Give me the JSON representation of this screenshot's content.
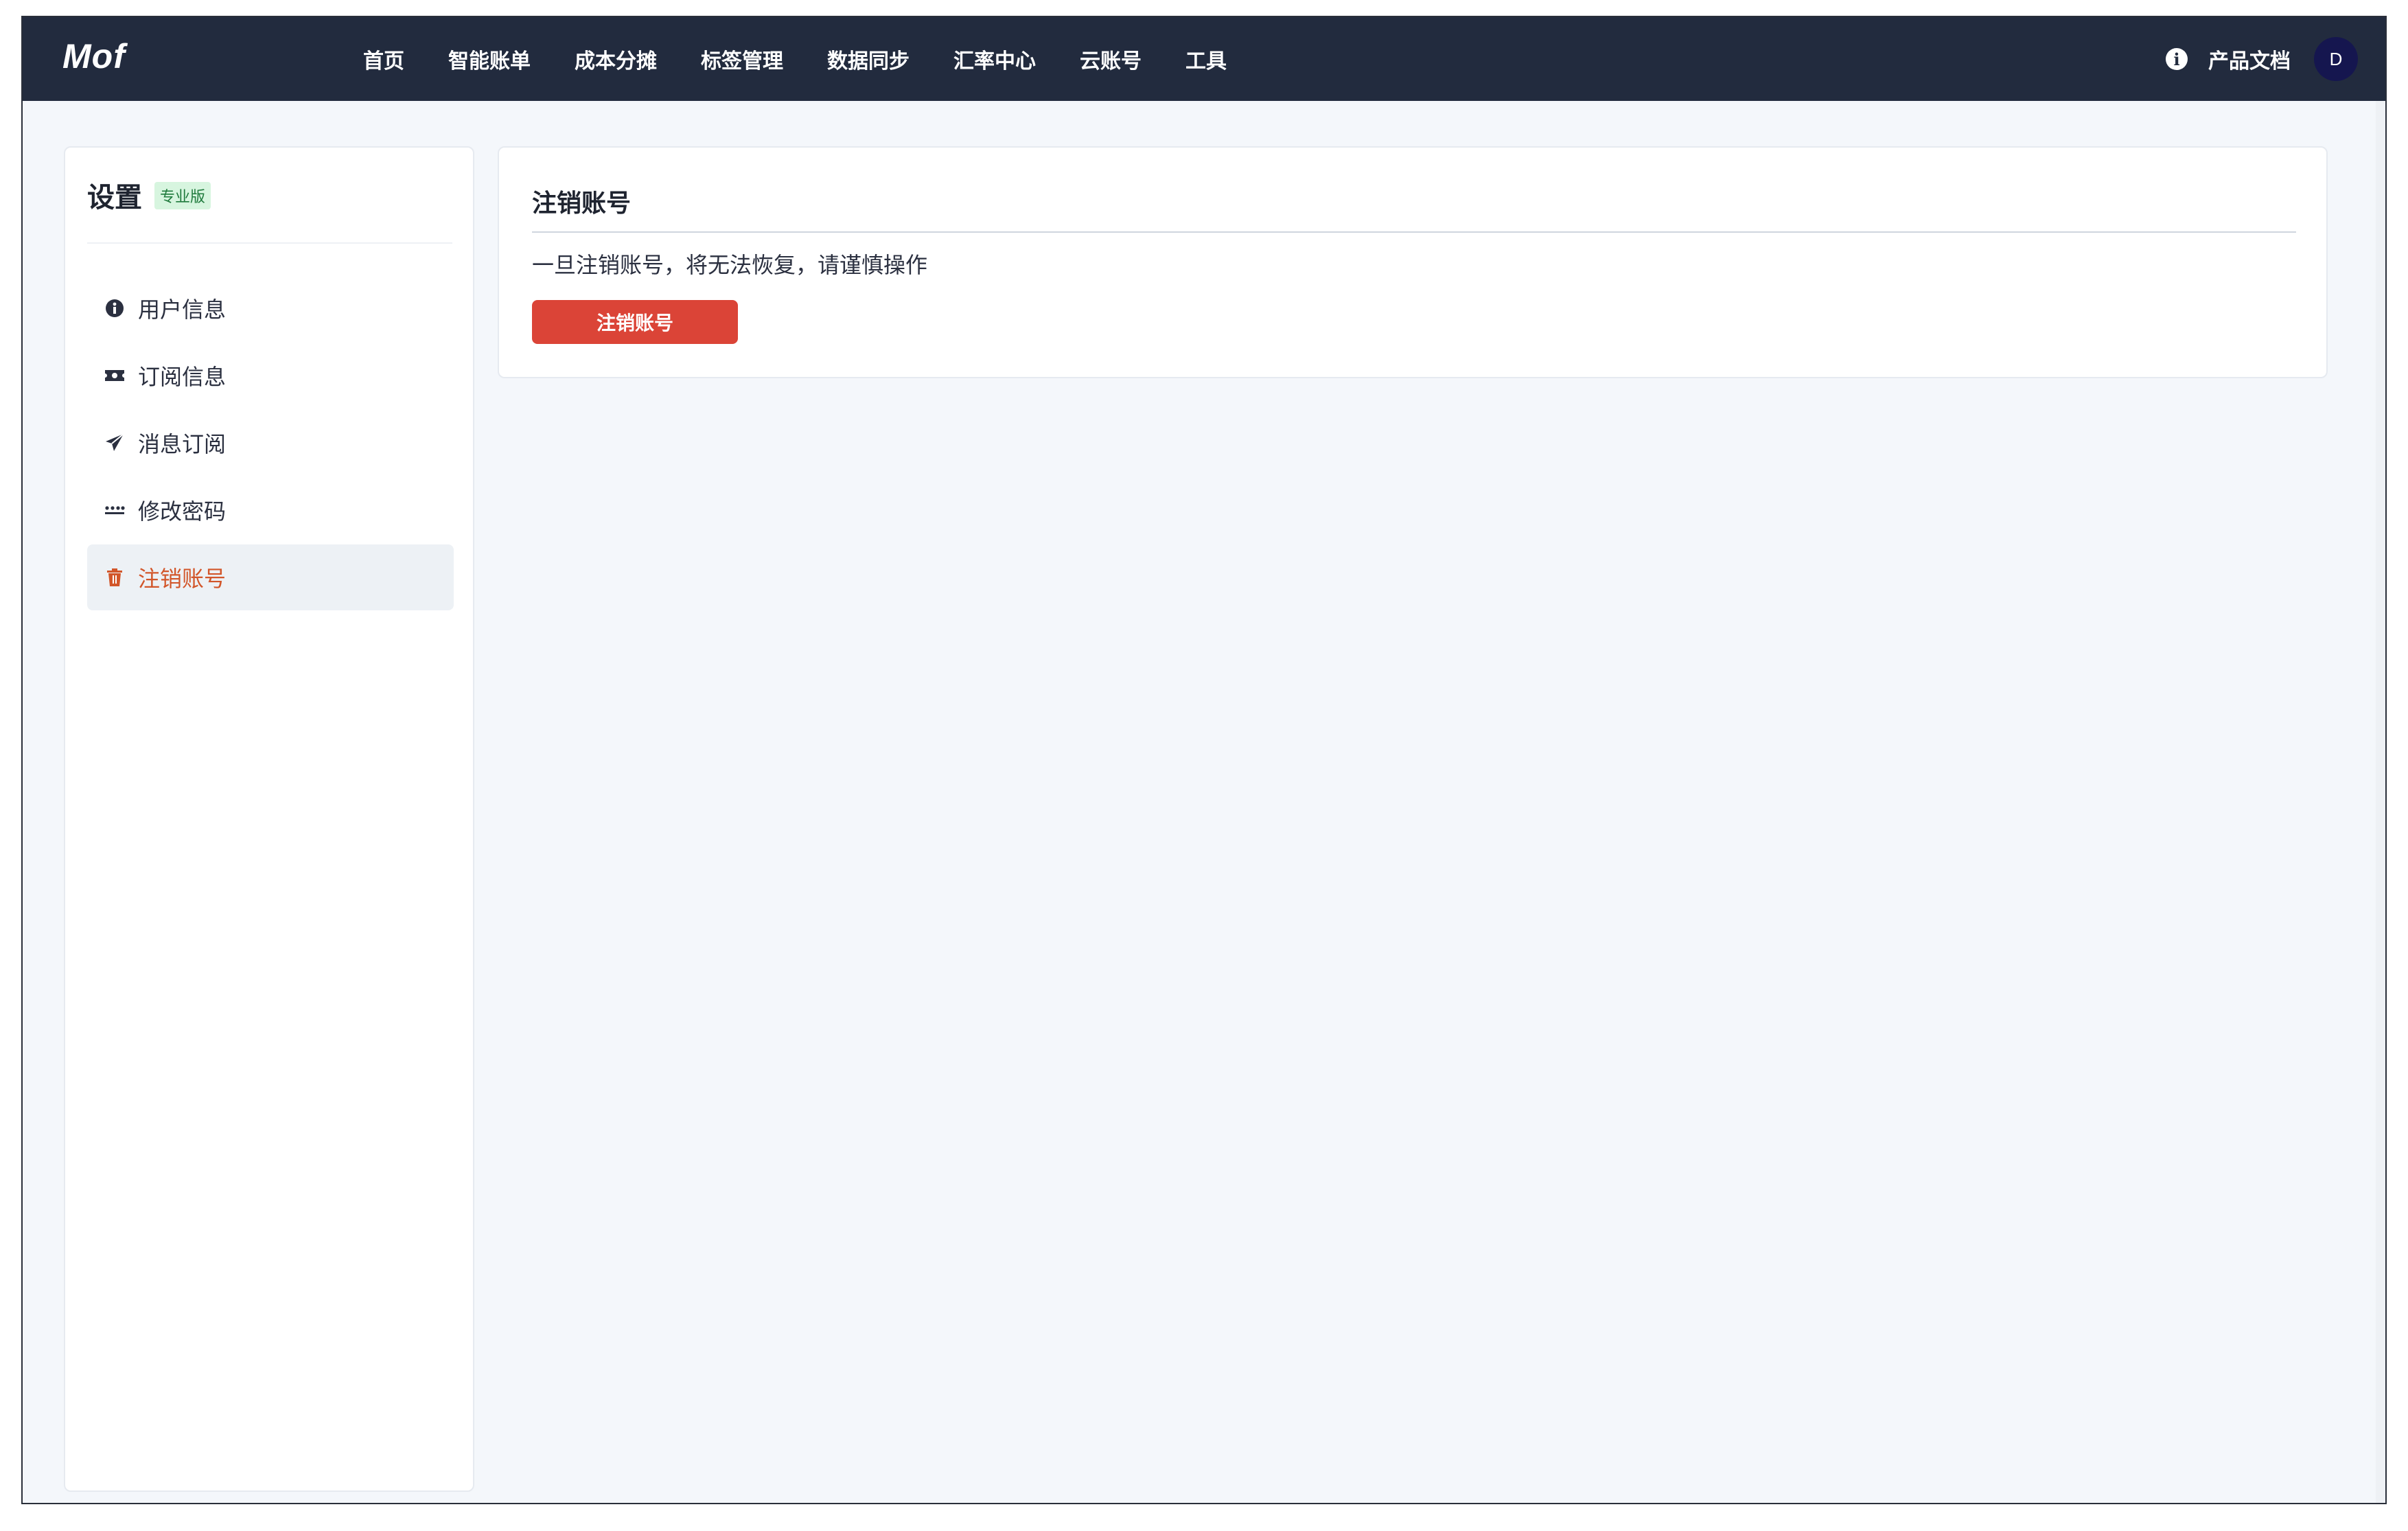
{
  "brand": "Mof",
  "nav": {
    "items": [
      "首页",
      "智能账单",
      "成本分摊",
      "标签管理",
      "数据同步",
      "汇率中心",
      "云账号",
      "工具"
    ],
    "docs": "产品文档",
    "avatar_initial": "D"
  },
  "sidebar": {
    "title": "设置",
    "badge": "专业版",
    "items": [
      {
        "label": "用户信息",
        "icon": "info-circle-icon"
      },
      {
        "label": "订阅信息",
        "icon": "ticket-icon"
      },
      {
        "label": "消息订阅",
        "icon": "paper-plane-icon"
      },
      {
        "label": "修改密码",
        "icon": "password-dots-icon"
      },
      {
        "label": "注销账号",
        "icon": "trash-icon",
        "active": true
      }
    ]
  },
  "main": {
    "title": "注销账号",
    "description": "一旦注销账号，将无法恢复，请谨慎操作",
    "button_label": "注销账号"
  },
  "colors": {
    "topbar": "#222b3e",
    "accent_active": "#d2562a",
    "danger": "#db4437",
    "avatar": "#15164f"
  }
}
